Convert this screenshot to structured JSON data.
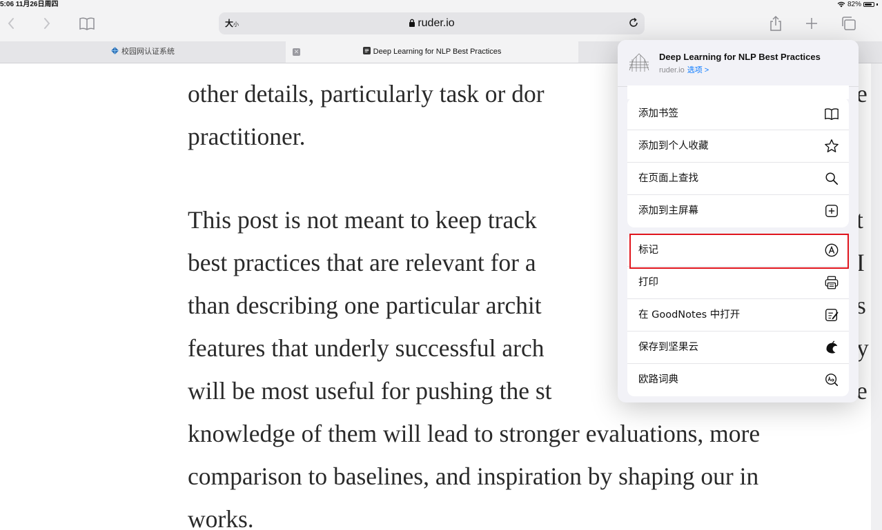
{
  "status_bar": {
    "time_date": "5:06  11月26日周四",
    "battery": "82%",
    "battery_level": 0.82
  },
  "toolbar": {
    "back_icon": "chevron-left-icon",
    "forward_icon": "chevron-right-icon",
    "bookmarks_icon": "book-icon",
    "text_size_label": "大",
    "text_size_small": "小",
    "url": "ruder.io",
    "reload_icon": "reload-icon",
    "share_icon": "share-icon",
    "new_tab_icon": "plus-icon",
    "tabs_icon": "tabs-icon"
  },
  "tabs": [
    {
      "label": "校园网认证系统"
    },
    {
      "label": "Deep Learning for NLP Best Practices"
    }
  ],
  "article": {
    "paragraph1_lines": [
      "other details, particularly task or dor",
      "practitioner."
    ],
    "paragraph2_lines": [
      "This post is not meant to keep track",
      "best practices that are relevant for a",
      "than describing one particular archit",
      "features that underly successful arch",
      "will be most useful for pushing the st",
      "knowledge of them will lead to stronger evaluations, more",
      "comparison to baselines, and inspiration by shaping our in",
      "works."
    ],
    "right_edge_fragments": [
      "e",
      "t",
      "I",
      "s",
      "y",
      "e"
    ]
  },
  "share_sheet": {
    "page_title": "Deep Learning for NLP Best Practices",
    "domain": "ruder.io",
    "options_label": "选项 >",
    "group1": [
      {
        "label": "添加书签",
        "icon": "book-icon"
      },
      {
        "label": "添加到个人收藏",
        "icon": "star-icon"
      },
      {
        "label": "在页面上查找",
        "icon": "search-icon"
      },
      {
        "label": "添加到主屏幕",
        "icon": "add-square-icon"
      }
    ],
    "group2": [
      {
        "label": "标记",
        "icon": "markup-icon"
      },
      {
        "label": "打印",
        "icon": "print-icon"
      },
      {
        "label": "在 GoodNotes 中打开",
        "icon": "goodnotes-icon"
      },
      {
        "label": "保存到坚果云",
        "icon": "nutstore-icon"
      },
      {
        "label": "欧路词典",
        "icon": "dictionary-icon"
      }
    ],
    "highlight_color": "#e0141c",
    "link_color": "#0a7aff"
  }
}
